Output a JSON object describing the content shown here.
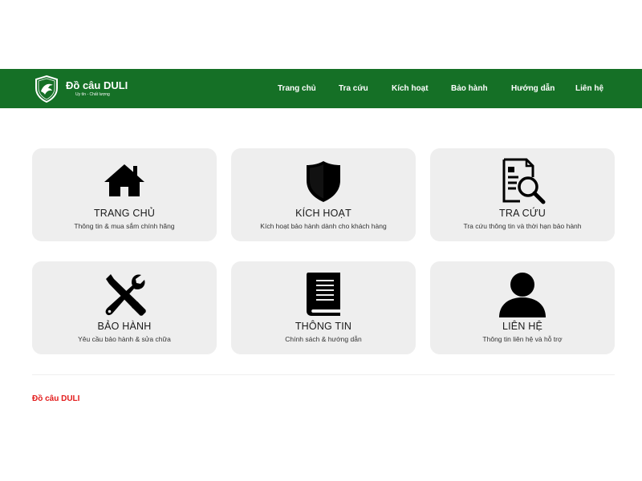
{
  "header": {
    "brand_name": "Đồ câu DULI",
    "brand_tagline": "Uy tín - Chất lượng",
    "nav": [
      {
        "label": "Trang chủ"
      },
      {
        "label": "Tra cứu"
      },
      {
        "label": "Kích hoạt"
      },
      {
        "label": "Bảo hành"
      },
      {
        "label": "Hướng dẫn"
      },
      {
        "label": "Liên hệ"
      }
    ]
  },
  "cards": [
    {
      "title": "TRANG CHỦ",
      "desc": "Thông tin & mua sắm chính hãng",
      "icon": "home-icon"
    },
    {
      "title": "KÍCH HOẠT",
      "desc": "Kích hoạt bảo hành dành cho khách hàng",
      "icon": "shield-icon"
    },
    {
      "title": "TRA CỨU",
      "desc": "Tra cứu thông tin và thời hạn bảo hành",
      "icon": "document-search-icon"
    },
    {
      "title": "BẢO HÀNH",
      "desc": "Yêu cầu bảo hành & sửa chữa",
      "icon": "tools-icon"
    },
    {
      "title": "THÔNG TIN",
      "desc": "Chính sách & hướng dẫn",
      "icon": "book-icon"
    },
    {
      "title": "LIÊN HỆ",
      "desc": "Thông tin liên hệ và hỗ trợ",
      "icon": "user-icon"
    }
  ],
  "footer": {
    "brand_name": "Đồ câu DULI"
  },
  "colors": {
    "header_bg": "#157026",
    "card_bg": "#eeeeee",
    "footer_brand": "#e31b1b"
  }
}
